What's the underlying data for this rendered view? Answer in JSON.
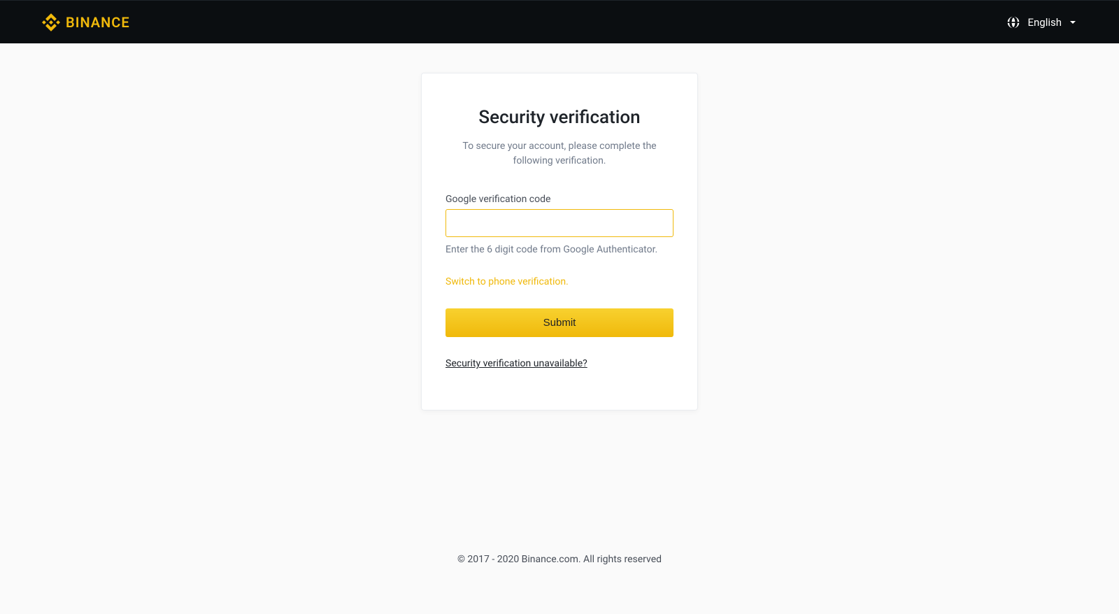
{
  "header": {
    "brand": "BINANCE",
    "language": "English"
  },
  "card": {
    "title": "Security verification",
    "description": "To secure your account, please complete the following verification.",
    "input_label": "Google verification code",
    "input_value": "",
    "helper_text": "Enter the 6 digit code from Google Authenticator.",
    "switch_link": "Switch to phone verification.",
    "submit_label": "Submit",
    "unavailable_link": "Security verification unavailable?"
  },
  "footer": {
    "copyright": "© 2017 - 2020 Binance.com. All rights reserved"
  },
  "colors": {
    "accent": "#f0b90b",
    "header_bg": "#0b0e11"
  }
}
